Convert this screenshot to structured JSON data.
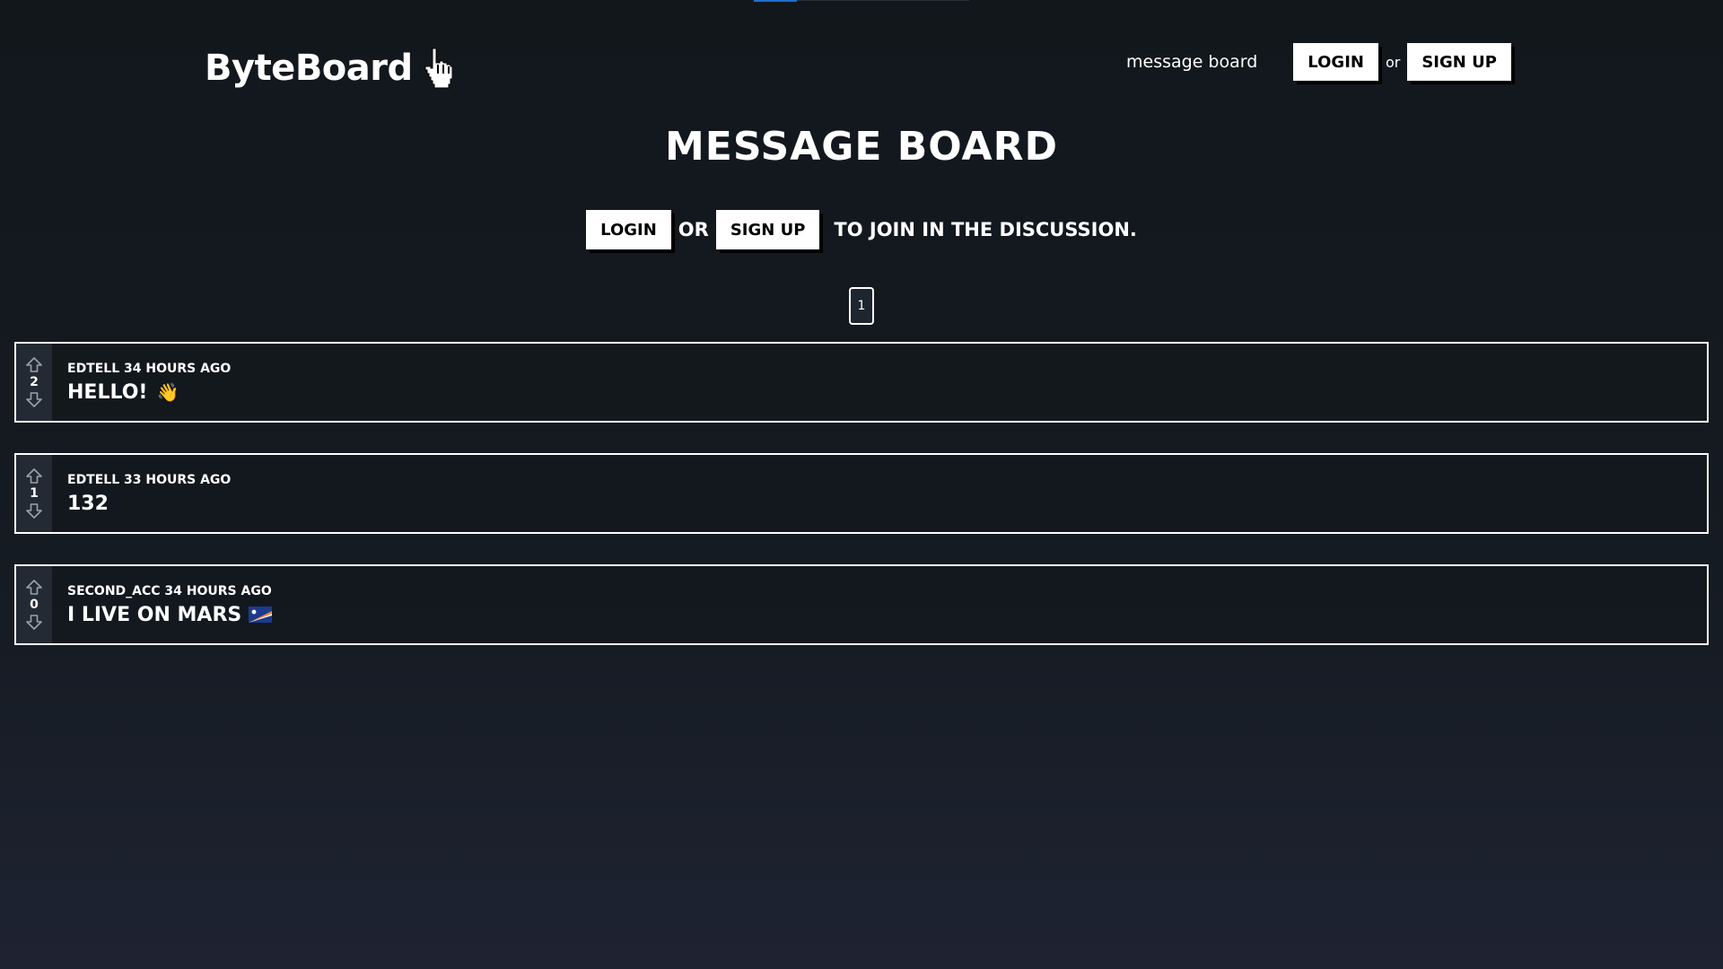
{
  "header": {
    "logo_text": "ByteBoard",
    "nav_link": "message board",
    "login_label": "LOGIN",
    "or_text": "or",
    "signup_label": "SIGN UP"
  },
  "main": {
    "title": "MESSAGE BOARD",
    "join": {
      "login_label": "LOGIN",
      "or_text": "OR",
      "signup_label": "SIGN UP",
      "tail_text": "TO JOIN IN THE DISCUSSION."
    },
    "pagination": {
      "current_page": "1"
    },
    "posts": [
      {
        "author": "EDTELL",
        "time": "34 HOURS AGO",
        "score": "2",
        "content": "HELLO!",
        "emoji": "waving-hand"
      },
      {
        "author": "EDTELL",
        "time": "33 HOURS AGO",
        "score": "1",
        "content": "132",
        "emoji": ""
      },
      {
        "author": "SECOND_ACC",
        "time": "34 HOURS AGO",
        "score": "0",
        "content": "I LIVE ON MARS",
        "emoji": "marshall-islands-flag"
      }
    ]
  },
  "colors": {
    "background_top": "#12171c",
    "background_bottom": "#1e2332",
    "accent": "#1f6fd1",
    "button_bg": "#ffffff",
    "button_text": "#000000"
  }
}
